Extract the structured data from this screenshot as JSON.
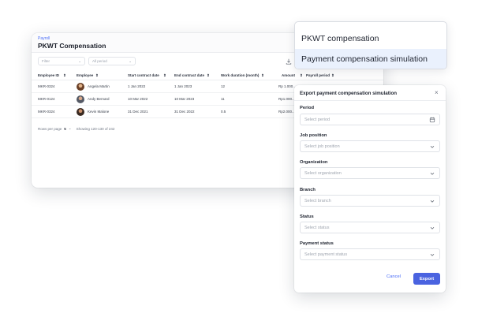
{
  "app": {
    "breadcrumb": "Payroll",
    "title": "PKWT Compensation",
    "filters": {
      "filter_label": "Filter",
      "period_label": "All period"
    },
    "table": {
      "headers": [
        "Employee ID",
        "Employee",
        "Start contract date",
        "End contract date",
        "Work duration (month)",
        "Amount",
        "Payroll period"
      ],
      "rows": [
        {
          "id": "MKR-0324",
          "employee": "Angela Martin",
          "start": "1 Jan 2022",
          "end": "1 Jan 2023",
          "duration": "12",
          "amount": "Rp 1.000..."
        },
        {
          "id": "MKR-0124",
          "employee": "Andy Bernard",
          "start": "10 Mar 2022",
          "end": "10 Mar 2023",
          "duration": "11",
          "amount": "Rp1.000..."
        },
        {
          "id": "MKR-0324",
          "employee": "Kevin Malone",
          "start": "31 Dec 2021",
          "end": "31 Dec 2022",
          "duration": "0.5",
          "amount": "Rp2.000..."
        }
      ]
    },
    "pager": {
      "rows_per_page_label": "Rows per page",
      "rows_per_page_value": "5",
      "showing": "Showing 120-130 of 242"
    }
  },
  "menu": {
    "items": [
      "PKWT compensation",
      "Payment compensation simulation"
    ],
    "selected_index": 1
  },
  "dialog": {
    "title": "Export payment compensation simulation",
    "fields": [
      {
        "label": "Period",
        "placeholder": "Select period",
        "icon": "calendar-icon"
      },
      {
        "label": "Job position",
        "placeholder": "Select job position",
        "icon": "chevron-down-icon"
      },
      {
        "label": "Organization",
        "placeholder": "Select organization",
        "icon": "chevron-down-icon"
      },
      {
        "label": "Branch",
        "placeholder": "Select branch",
        "icon": "chevron-down-icon"
      },
      {
        "label": "Status",
        "placeholder": "Select status",
        "icon": "chevron-down-icon"
      },
      {
        "label": "Payment status",
        "placeholder": "Select payment status",
        "icon": "chevron-down-icon"
      }
    ],
    "cancel_label": "Cancel",
    "export_label": "Export"
  },
  "colors": {
    "accent": "#4a63e0",
    "link": "#4a6cf7",
    "menu_selected_bg": "#eaf1fd"
  }
}
